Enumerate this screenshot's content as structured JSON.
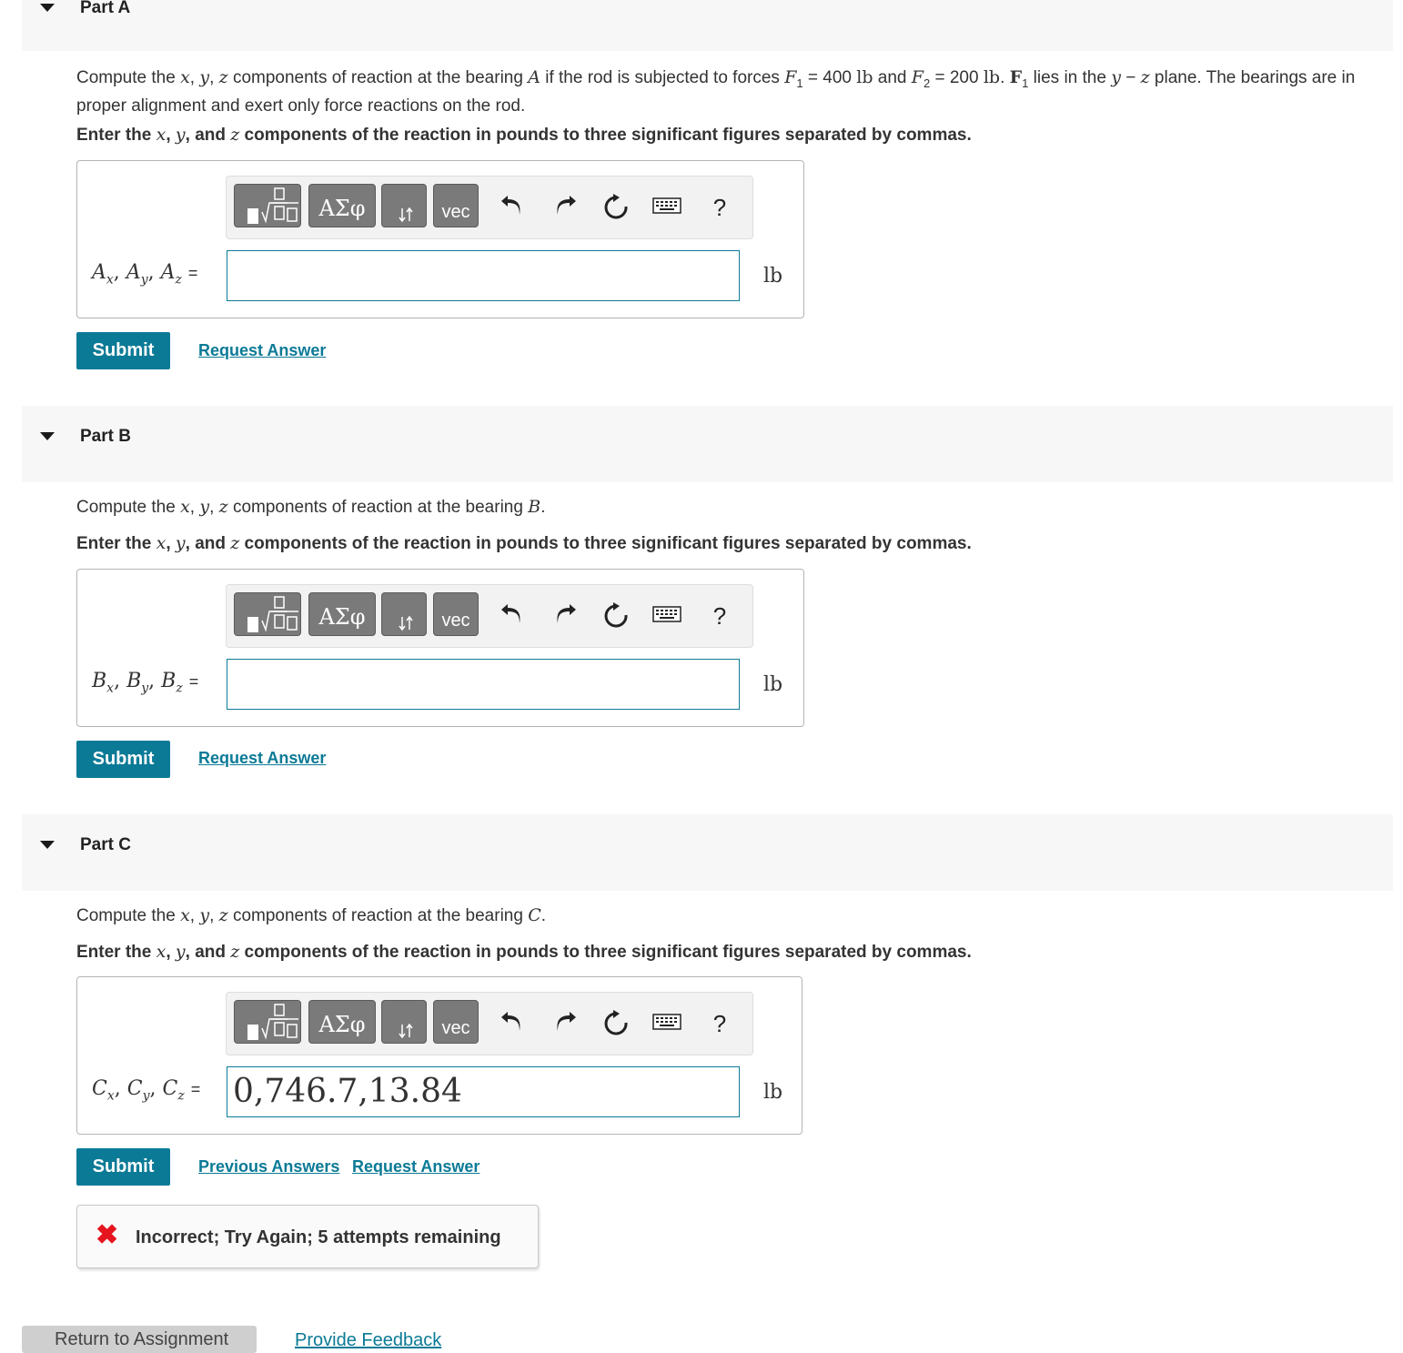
{
  "parts": [
    {
      "title": "Part A",
      "prompt_text": "Compute the x, y, z components of reaction at the bearing A if the rod is subjected to forces F1 = 400 lb and F2 = 200 lb. F1 lies in the y − z plane. The bearings are in proper alignment and exert only force reactions on the rod.",
      "instruction": "Enter the x, y, and z components of the reaction in pounds to three significant figures separated by commas.",
      "answer_label": "Ax, Ay, Az =",
      "answer_value": "",
      "unit": "lb",
      "links": [
        "Request Answer"
      ]
    },
    {
      "title": "Part B",
      "prompt_text": "Compute the x, y, z components of reaction at the bearing B.",
      "instruction": "Enter the x, y, and z components of the reaction in pounds to three significant figures separated by commas.",
      "answer_label": "Bx, By, Bz =",
      "answer_value": "",
      "unit": "lb",
      "links": [
        "Request Answer"
      ]
    },
    {
      "title": "Part C",
      "prompt_text": "Compute the x, y, z components of reaction at the bearing C.",
      "instruction": "Enter the x, y, and z components of the reaction in pounds to three significant figures separated by commas.",
      "answer_label": "Cx, Cy, Cz =",
      "answer_value": "0,746.7,13.84",
      "unit": "lb",
      "links": [
        "Previous Answers",
        "Request Answer"
      ]
    }
  ],
  "toolbar": {
    "greek_label": "ΑΣφ",
    "vec_label": "vec",
    "help_label": "?",
    "icons": [
      "templates-icon",
      "greek-icon",
      "subscript-icon",
      "vec-icon",
      "undo-icon",
      "redo-icon",
      "reset-icon",
      "keyboard-icon",
      "help-icon"
    ]
  },
  "submit_label": "Submit",
  "feedback": {
    "text": "Incorrect; Try Again; 5 attempts remaining",
    "icon": "x-icon",
    "color": "#e5141e"
  },
  "footer": {
    "return_label": "Return to Assignment",
    "feedback_label": "Provide Feedback"
  },
  "colors": {
    "accent": "#0b7a96",
    "header_bg": "#f7f7f7",
    "toolbar_button": "#7a7a7a"
  }
}
